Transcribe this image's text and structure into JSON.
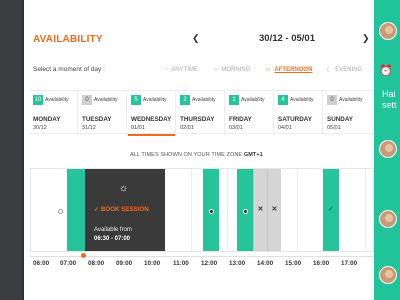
{
  "header": {
    "title": "AVAILABILITY",
    "prev_icon": "chevron-left-icon",
    "next_icon": "chevron-right-icon",
    "date_range": "30/12 - 05/01"
  },
  "moments": {
    "label": "Select a moment of day :",
    "options": [
      {
        "label": "ANYTIME",
        "icon": "circle-icon",
        "active": false
      },
      {
        "label": "MORNING",
        "icon": "sunrise-icon",
        "active": false
      },
      {
        "label": "AFTERNOON",
        "icon": "sun-icon",
        "active": true
      },
      {
        "label": "EVENING",
        "icon": "moon-icon",
        "active": false
      }
    ]
  },
  "days": [
    {
      "count": "10",
      "availability": "Availability",
      "name": "MONDAY",
      "date": "30/12",
      "available": true,
      "active": false
    },
    {
      "count": "0",
      "availability": "Availability",
      "name": "TUESDAY",
      "date": "31/12",
      "available": false,
      "active": false
    },
    {
      "count": "5",
      "availability": "Availability",
      "name": "WEDNESDAY",
      "date": "01/01",
      "available": true,
      "active": true
    },
    {
      "count": "2",
      "availability": "Availability",
      "name": "THURSDAY",
      "date": "02/01",
      "available": true,
      "active": false
    },
    {
      "count": "1",
      "availability": "Availability",
      "name": "FRIDAY",
      "date": "03/01",
      "available": true,
      "active": false
    },
    {
      "count": "4",
      "availability": "Availability",
      "name": "SATURDAY",
      "date": "04/01",
      "available": true,
      "active": false
    },
    {
      "count": "0",
      "availability": "Availability",
      "name": "SUNDAY",
      "date": "05/01",
      "available": false,
      "active": false
    }
  ],
  "timezone": {
    "prefix": "ALL TIMES SHOWN ON YOUR TIME ZONE",
    "zone": "GMT+1"
  },
  "booking_card": {
    "icon": "sun-icon",
    "book_label": "BOOK SESSION",
    "available_from": "Available from",
    "range": "06:30 - 07:00"
  },
  "hours": [
    "06:00",
    "07:00",
    "08:00",
    "09:00",
    "10:00",
    "11:00",
    "12:00",
    "13:00",
    "14:00",
    "15:00",
    "16:00",
    "17:00"
  ],
  "right_panel": {
    "clock_icon": "alarm-clock-icon",
    "text_line1": "Hai",
    "text_line2": "sett"
  },
  "colors": {
    "accent_orange": "#ef6c1f",
    "available_green": "#26c49a",
    "panel_green": "#20c39a",
    "dark_card": "#3a3a3a"
  }
}
